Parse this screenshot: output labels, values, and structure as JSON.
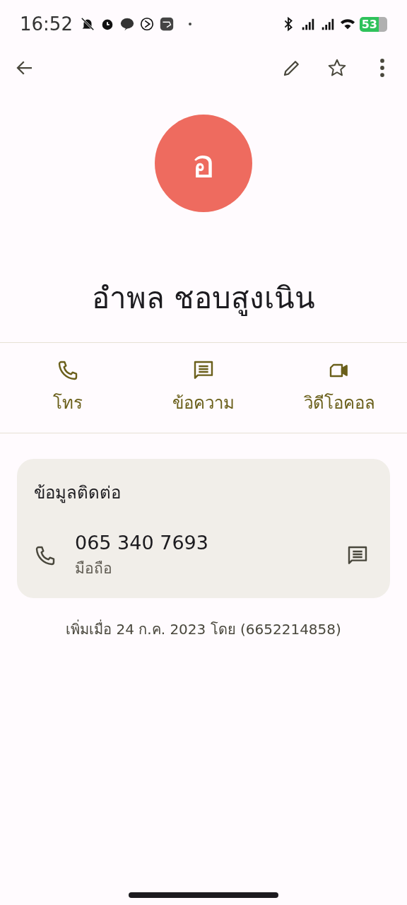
{
  "status_bar": {
    "time": "16:52",
    "battery": "53"
  },
  "contact": {
    "initial": "อ",
    "name": "อำพล ชอบสูงเนิน"
  },
  "actions": [
    {
      "kind": "call",
      "label": "โทร"
    },
    {
      "kind": "message",
      "label": "ข้อความ"
    },
    {
      "kind": "video",
      "label": "วิดีโอคอล"
    }
  ],
  "contact_info": {
    "title": "ข้อมูลติดต่อ",
    "phones": [
      {
        "number": "065 340 7693",
        "type": "มือถือ"
      }
    ]
  },
  "added_note": "เพิ่มเมื่อ 24 ก.ค. 2023 โดย (6652214858)"
}
